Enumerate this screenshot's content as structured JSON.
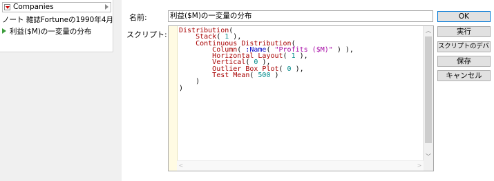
{
  "tree": {
    "header_title": "Companies",
    "note": "ノート 雑誌Fortuneの1990年4月",
    "script_item": "利益($M)の一変量の分布"
  },
  "form": {
    "name_label": "名前:",
    "name_value": "利益($M)の一変量の分布",
    "script_label": "スクリプト:"
  },
  "buttons": {
    "ok": "OK",
    "run": "実行",
    "debug": "スクリプトのデバッグ",
    "save": "保存",
    "cancel": "キャンセル"
  },
  "script_lines": [
    "Distribution(",
    "    Stack( 1 ),",
    "    Continuous Distribution(",
    "        Column( :Name( \"Profits ($M)\" ) ),",
    "        Horizontal Layout( 1 ),",
    "        Vertical( 0 ),",
    "        Outlier Box Plot( 0 ),",
    "        Test Mean( 500 )",
    "    )",
    ")"
  ],
  "colors": {
    "keyword": "#a80000",
    "string": "#a300a3",
    "number": "#008a8a",
    "name_fn": "#0000c8",
    "accent": "#0078d7",
    "play_icon": "#3c9d3c"
  }
}
